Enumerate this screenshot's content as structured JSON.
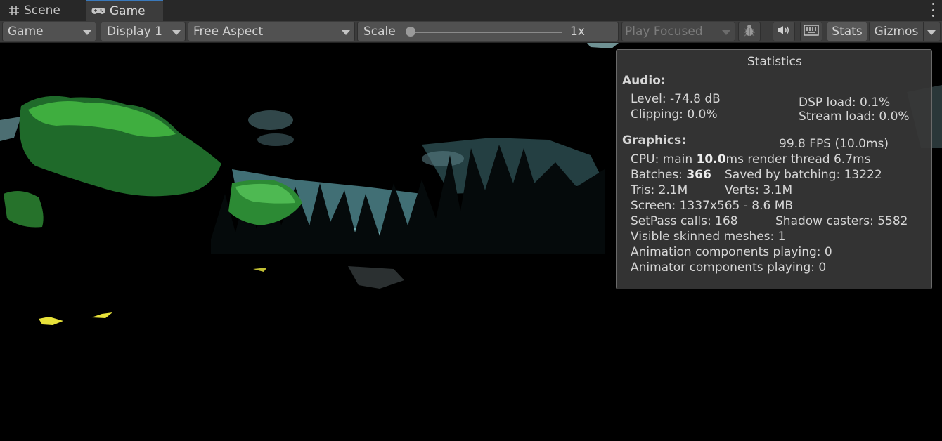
{
  "tabs": {
    "scene": "Scene",
    "game": "Game"
  },
  "toolbar": {
    "game_dropdown": "Game",
    "display_dropdown": "Display 1",
    "aspect_dropdown": "Free Aspect",
    "scale_label": "Scale",
    "scale_value": "1x",
    "scale_fraction": 0.0,
    "play_mode": "Play Focused",
    "stats_label": "Stats",
    "gizmos_label": "Gizmos"
  },
  "statistics": {
    "title": "Statistics",
    "audio_header": "Audio:",
    "level": "Level: -74.8 dB",
    "clipping": "Clipping: 0.0%",
    "dsp_load": "DSP load: 0.1%",
    "stream_load": "Stream load: 0.0%",
    "graphics_header": "Graphics:",
    "fps": "99.8 FPS (10.0ms)",
    "cpu_prefix": "CPU: main ",
    "cpu_main": "10.0",
    "cpu_suffix": "ms  render thread 6.7ms",
    "batches_prefix": "Batches: ",
    "batches": "366",
    "saved_by_batching": "Saved by batching: 13222",
    "tris": "Tris: 2.1M",
    "verts": "Verts: 3.1M",
    "screen": "Screen: 1337x565 - 8.6 MB",
    "setpass": "SetPass calls: 168",
    "shadow_casters": "Shadow casters: 5582",
    "skinned_meshes": "Visible skinned meshes: 1",
    "animation_components": "Animation components playing: 0",
    "animator_components": "Animator components playing: 0"
  },
  "colors": {
    "tab_active_accent": "#3a79bb",
    "toolbar_bg": "#3c3c3c",
    "panel_bg": "#373737",
    "foliage_green": "#3fae3f",
    "sky_teal": "#7fc4c8"
  },
  "icons": [
    "grid-icon",
    "gamepad-icon",
    "bug-icon",
    "speaker-icon",
    "keyboard-icon",
    "more-vertical-icon"
  ]
}
